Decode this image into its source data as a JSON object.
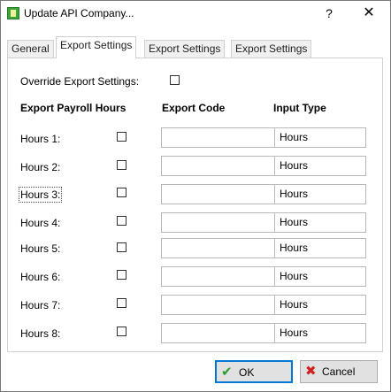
{
  "window": {
    "title": "Update API Company...",
    "help_label": "?",
    "close_label": "✕"
  },
  "tabs": [
    {
      "label": "General",
      "active": false
    },
    {
      "label": "Export Settings",
      "active": true
    },
    {
      "label": "Export Settings",
      "active": false
    },
    {
      "label": "Export Settings",
      "active": false
    }
  ],
  "override": {
    "label": "Override Export Settings:",
    "checked": false
  },
  "columns": {
    "hours": "Export Payroll Hours",
    "code": "Export Code",
    "type": "Input Type"
  },
  "rows": [
    {
      "label": "Hours 1:",
      "checked": false,
      "code": "",
      "input_type": "Hours"
    },
    {
      "label": "Hours 2:",
      "checked": false,
      "code": "",
      "input_type": "Hours"
    },
    {
      "label": "Hours 3:",
      "checked": false,
      "code": "",
      "input_type": "Hours"
    },
    {
      "label": "Hours 4:",
      "checked": false,
      "code": "",
      "input_type": "Hours"
    },
    {
      "label": "Hours 5:",
      "checked": false,
      "code": "",
      "input_type": "Hours"
    },
    {
      "label": "Hours 6:",
      "checked": false,
      "code": "",
      "input_type": "Hours"
    },
    {
      "label": "Hours 7:",
      "checked": false,
      "code": "",
      "input_type": "Hours"
    },
    {
      "label": "Hours 8:",
      "checked": false,
      "code": "",
      "input_type": "Hours"
    }
  ],
  "buttons": {
    "ok": "OK",
    "cancel": "Cancel"
  },
  "icons": {
    "app": "app-icon",
    "ok": "checkmark-icon",
    "cancel": "x-icon"
  },
  "colors": {
    "default_button_border": "#0078d7",
    "ok_icon": "#2e9b2e",
    "cancel_icon": "#d02020"
  }
}
